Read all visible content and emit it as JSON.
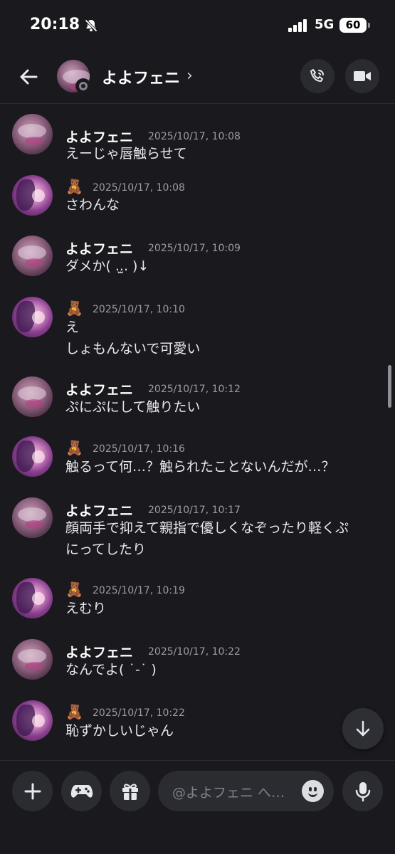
{
  "status_bar": {
    "time": "20:18",
    "network": "5G",
    "battery": "60"
  },
  "header": {
    "title": "よよフェニ",
    "chevron": "›"
  },
  "messages": [
    {
      "sender": "よよフェニ",
      "timestamp": "2025/10/17, 10:08",
      "lines": [
        "えーじゃ唇触らせて"
      ]
    },
    {
      "sender_icon": "🧸",
      "timestamp": "2025/10/17, 10:08",
      "lines": [
        "さわんな"
      ]
    },
    {
      "sender": "よよフェニ",
      "timestamp": "2025/10/17, 10:09",
      "lines": [
        "ダメか(  ..̫. )↓"
      ]
    },
    {
      "sender_icon": "🧸",
      "timestamp": "2025/10/17, 10:10",
      "lines": [
        "え",
        "しょもんないで可愛い"
      ]
    },
    {
      "sender": "よよフェニ",
      "timestamp": "2025/10/17, 10:12",
      "lines": [
        "ぷにぷにして触りたい"
      ]
    },
    {
      "sender_icon": "🧸",
      "timestamp": "2025/10/17, 10:16",
      "lines": [
        "触るって何…？触られたことないんだが…？"
      ]
    },
    {
      "sender": "よよフェニ",
      "timestamp": "2025/10/17, 10:17",
      "lines": [
        "顔両手で抑えて親指で優しくなぞったり軽くぷ",
        "にってしたり"
      ]
    },
    {
      "sender_icon": "🧸",
      "timestamp": "2025/10/17, 10:19",
      "lines": [
        "えむり"
      ]
    },
    {
      "sender": "よよフェニ",
      "timestamp": "2025/10/17, 10:22",
      "lines": [
        "なんでよ( ˙-˙ )"
      ]
    },
    {
      "sender_icon": "🧸",
      "timestamp": "2025/10/17, 10:22",
      "lines": [
        "恥ずかしいじゃん"
      ]
    }
  ],
  "composer": {
    "placeholder": "@よよフェニ へ…"
  },
  "colors": {
    "background": "#1a1a1e",
    "button_bg": "#2b2c31",
    "timestamp": "#9b9ca3"
  }
}
